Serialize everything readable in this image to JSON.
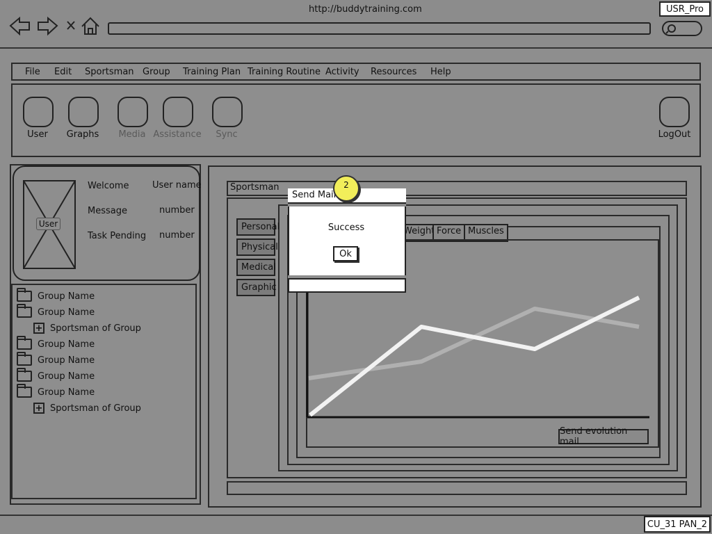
{
  "browser": {
    "url": "http://buddytraining.com",
    "user_badge": "USR_Pro",
    "footer_badge": "CU_31 PAN_2"
  },
  "menu": [
    "File",
    "Edit",
    "Sportsman",
    "Group",
    "Training Plan",
    "Training Routine",
    "Activity",
    "Resources",
    "Help"
  ],
  "toolbar": {
    "user": "User",
    "graphs": "Graphs",
    "media": "Media",
    "assistance": "Assistance",
    "sync": "Sync",
    "logout": "LogOut"
  },
  "profile": {
    "avatar_label": "User",
    "welcome_label": "Welcome",
    "welcome_value": "User name",
    "message_label": "Message",
    "message_value": "number",
    "task_label": "Task Pending",
    "task_value": "number"
  },
  "tree": [
    {
      "type": "folder",
      "label": "Group Name"
    },
    {
      "type": "folder-open",
      "label": "Group Name"
    },
    {
      "type": "child",
      "label": "Sportsman of Group"
    },
    {
      "type": "folder",
      "label": "Group Name"
    },
    {
      "type": "folder",
      "label": "Group Name"
    },
    {
      "type": "folder",
      "label": "Group Name"
    },
    {
      "type": "folder-open",
      "label": "Group Name"
    },
    {
      "type": "child",
      "label": "Sportsman of Group"
    }
  ],
  "main": {
    "panel_title": "Sportsman",
    "side_tabs": [
      "Personal",
      "Physical",
      "Medical",
      "Graphic"
    ],
    "top_tabs": [
      "Weight",
      "Force",
      "Muscles"
    ],
    "send_button": "Send evolution mail"
  },
  "dialog": {
    "title": "Send Mail",
    "message": "Success",
    "ok": "Ok",
    "callout": "2"
  },
  "colors": {
    "line_light": "#f2f2f2",
    "line_gray": "#b0b0b0",
    "callout": "#f2ee5a"
  }
}
